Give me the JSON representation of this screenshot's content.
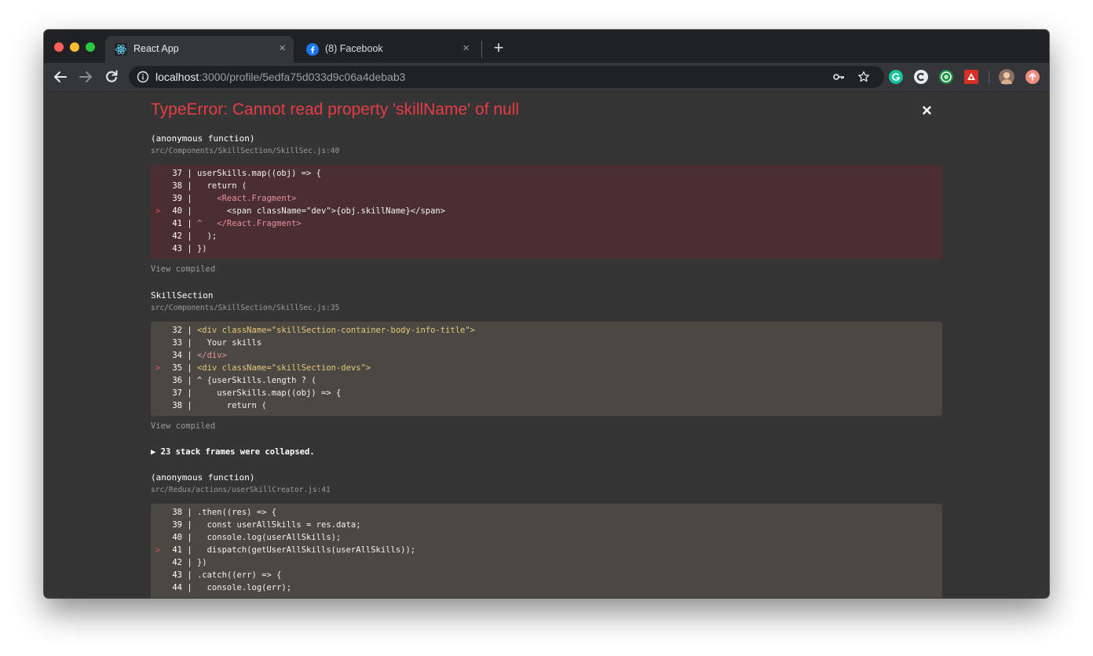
{
  "tabs": [
    {
      "title": "React App",
      "close": "×"
    },
    {
      "title": "(8) Facebook",
      "close": "×"
    }
  ],
  "newtab": "+",
  "address": {
    "host": "localhost",
    "rest": ":3000/profile/5edfa75d033d9c06a4debab3"
  },
  "error": {
    "title": "TypeError: Cannot read property 'skillName' of null",
    "close": "×",
    "frames": [
      {
        "fn": "(anonymous function)",
        "file": "src/Components/SkillSection/SkillSec.js:40",
        "view": "View compiled",
        "lines": [
          {
            "marker": "",
            "no": "37",
            "code": "userSkills.map((obj) => {"
          },
          {
            "marker": "",
            "no": "38",
            "code": "  return ("
          },
          {
            "marker": "",
            "no": "39",
            "code": "    <React.Fragment>"
          },
          {
            "marker": ">",
            "no": "40",
            "code": "      <span className=\"dev\">{obj.skillName}</span>"
          },
          {
            "marker": "",
            "no": "41",
            "code": "^   </React.Fragment>"
          },
          {
            "marker": "",
            "no": "42",
            "code": "  );"
          },
          {
            "marker": "",
            "no": "43",
            "code": "})"
          }
        ]
      },
      {
        "fn": "SkillSection",
        "file": "src/Components/SkillSection/SkillSec.js:35",
        "view": "View compiled",
        "lines": [
          {
            "marker": "",
            "no": "32",
            "code": "<div className=\"skillSection-container-body-info-title\">"
          },
          {
            "marker": "",
            "no": "33",
            "code": "  Your skills"
          },
          {
            "marker": "",
            "no": "34",
            "code": "</div>"
          },
          {
            "marker": ">",
            "no": "35",
            "code": "<div className=\"skillSection-devs\">"
          },
          {
            "marker": "",
            "no": "36",
            "code": "^ {userSkills.length ? ("
          },
          {
            "marker": "",
            "no": "37",
            "code": "    userSkills.map((obj) => {"
          },
          {
            "marker": "",
            "no": "38",
            "code": "      return ("
          }
        ]
      },
      {
        "fn": "(anonymous function)",
        "file": "src/Redux/actions/userSkillCreator.js:41",
        "view": "",
        "lines": [
          {
            "marker": "",
            "no": "38",
            "code": ".then((res) => {"
          },
          {
            "marker": "",
            "no": "39",
            "code": "  const userAllSkills = res.data;"
          },
          {
            "marker": "",
            "no": "40",
            "code": "  console.log(userAllSkills);"
          },
          {
            "marker": ">",
            "no": "41",
            "code": "  dispatch(getUserAllSkills(userAllSkills));"
          },
          {
            "marker": "",
            "no": "42",
            "code": "})"
          },
          {
            "marker": "",
            "no": "43",
            "code": ".catch((err) => {"
          },
          {
            "marker": "",
            "no": "44",
            "code": "  console.log(err);"
          }
        ]
      }
    ],
    "collapsed": "▶ 23 stack frames were collapsed."
  },
  "colors": {
    "error_red": "#e83b46",
    "error_box": "#4a2e31",
    "code_box": "#4a4842"
  }
}
